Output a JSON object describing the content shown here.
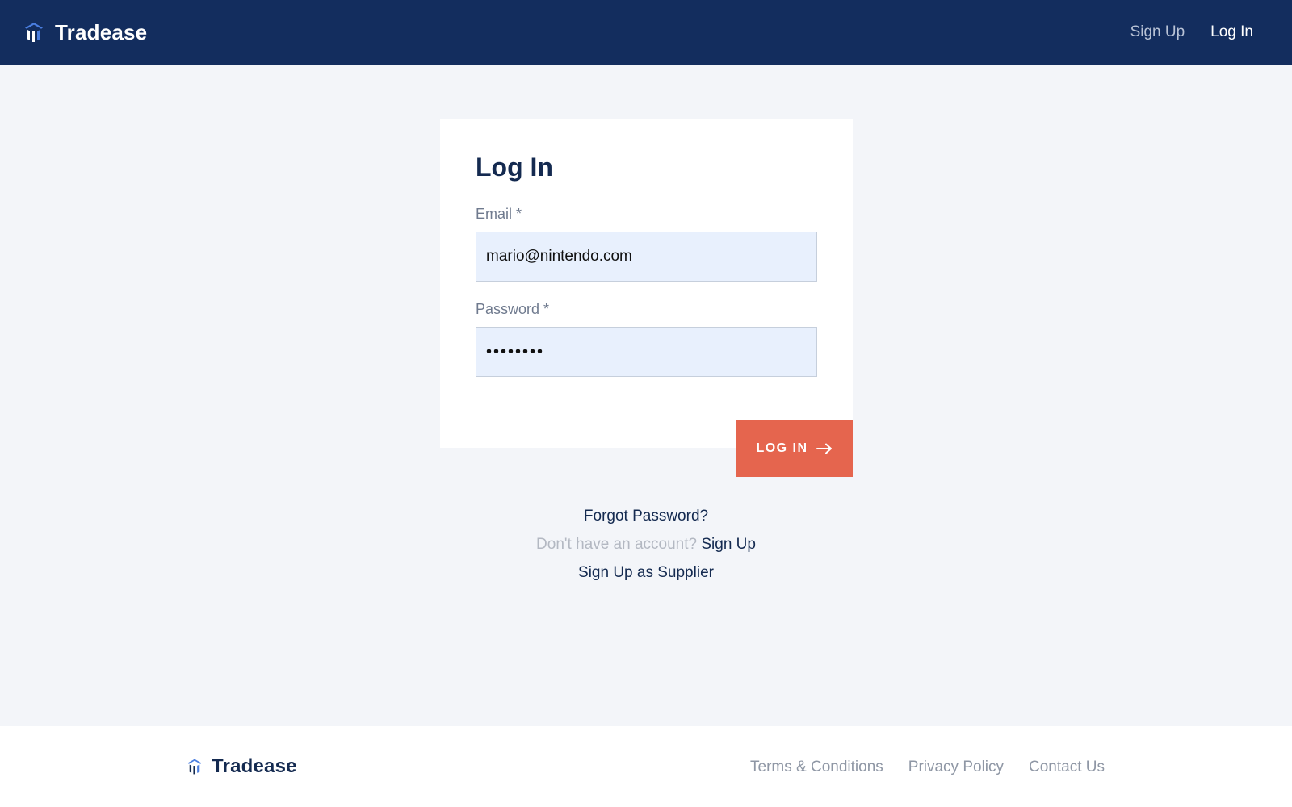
{
  "header": {
    "brand_name": "Tradease",
    "nav": {
      "signup_label": "Sign Up",
      "login_label": "Log In"
    }
  },
  "login_form": {
    "title": "Log In",
    "email": {
      "label": "Email *",
      "value": "mario@nintendo.com"
    },
    "password": {
      "label": "Password *",
      "value": "password"
    },
    "submit_label": "LOG IN"
  },
  "links": {
    "forgot_password": "Forgot Password?",
    "no_account_text": "Don't have an account?",
    "signup_link": "Sign Up",
    "signup_supplier": "Sign Up as Supplier"
  },
  "footer": {
    "brand_name": "Tradease",
    "links": [
      "Terms & Conditions",
      "Privacy Policy",
      "Contact Us"
    ]
  },
  "icons": {
    "brand_logo": "tradease-logo-icon",
    "submit_arrow": "arrow-right-icon"
  },
  "colors": {
    "header_bg": "#132d5e",
    "page_bg": "#f3f5f9",
    "primary_button": "#e5654e",
    "input_bg": "#e8f0fd",
    "text_dark": "#142a50"
  }
}
